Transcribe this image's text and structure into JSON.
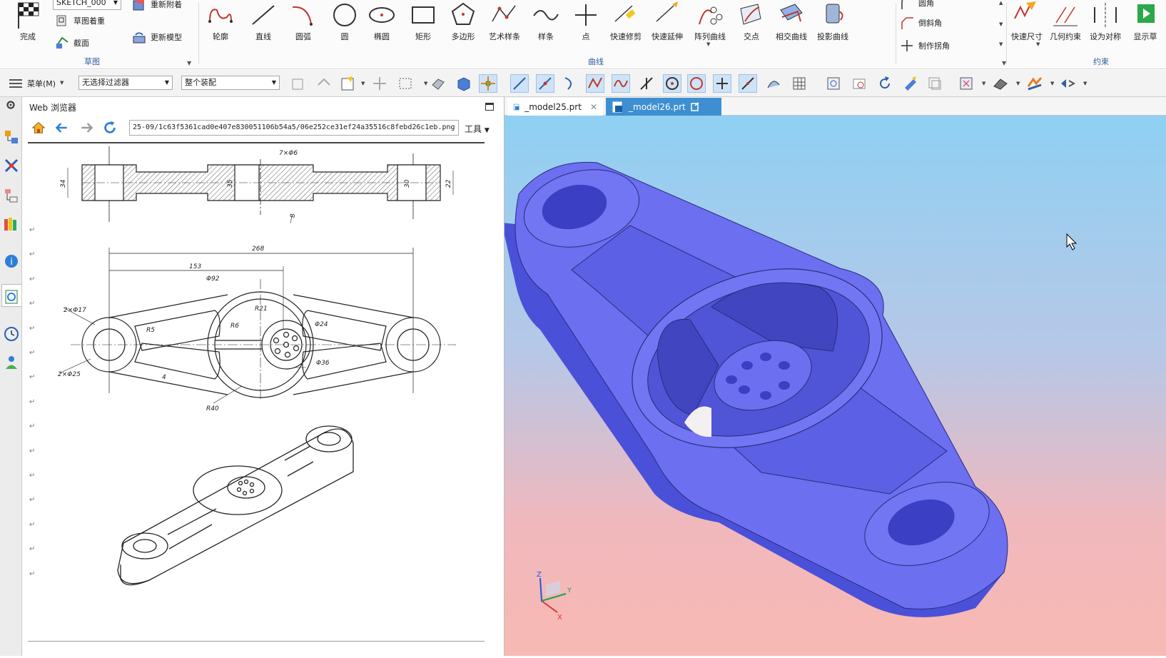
{
  "ribbon": {
    "sketch_group": {
      "label": "草图",
      "finish": "完成",
      "sketch_name": "SKETCH_000",
      "items": [
        "草图着重",
        "截面",
        "重新附着",
        "更新模型"
      ]
    },
    "curve_group": {
      "label": "曲线",
      "tools": [
        "轮廓",
        "直线",
        "圆弧",
        "圆",
        "椭圆",
        "矩形",
        "多边形",
        "艺术样条",
        "样条",
        "点",
        "快速修剪",
        "快速延伸",
        "阵列曲线",
        "交点",
        "相交曲线",
        "投影曲线"
      ],
      "side_items": [
        "圆角",
        "倒斜角",
        "制作拐角"
      ]
    },
    "constraint_group": {
      "label": "约束",
      "tools": [
        "快速尺寸",
        "几何约束",
        "设为对称",
        "显示草"
      ]
    }
  },
  "toolbar": {
    "menu_label": "菜单(M)",
    "filter_value": "无选择过滤器",
    "scope_value": "整个装配"
  },
  "web_panel": {
    "title": "Web 浏览器",
    "url": "25-09/1c63f5361cad0e407e830051106b54a5/06e252ce31ef24a35516c8febd26c1eb.png",
    "tools_label": "工具",
    "dims": {
      "top_hole": "7×Φ6",
      "left_h": "34",
      "mid_h": "35",
      "right_h": "22",
      "right_h2": "30",
      "rib": "8",
      "overall": "268",
      "half": "153",
      "d92": "Φ92",
      "r21": "R21",
      "r6": "R6",
      "r5": "R5",
      "d24": "Φ24",
      "d36": "Φ36",
      "holes_small": "2×Φ17",
      "holes_big": "2×Φ25",
      "r40": "R40",
      "thin": "4"
    }
  },
  "graphics": {
    "tabs": [
      {
        "name": "_model25.prt",
        "active": false
      },
      {
        "name": "_model26.prt",
        "active": true
      }
    ],
    "colors": {
      "part": "#6b6ff0",
      "part_dark": "#4b50d8",
      "edge": "#2a2c7a"
    },
    "triad": {
      "z": "Z",
      "y": "Y",
      "x": "X"
    }
  }
}
